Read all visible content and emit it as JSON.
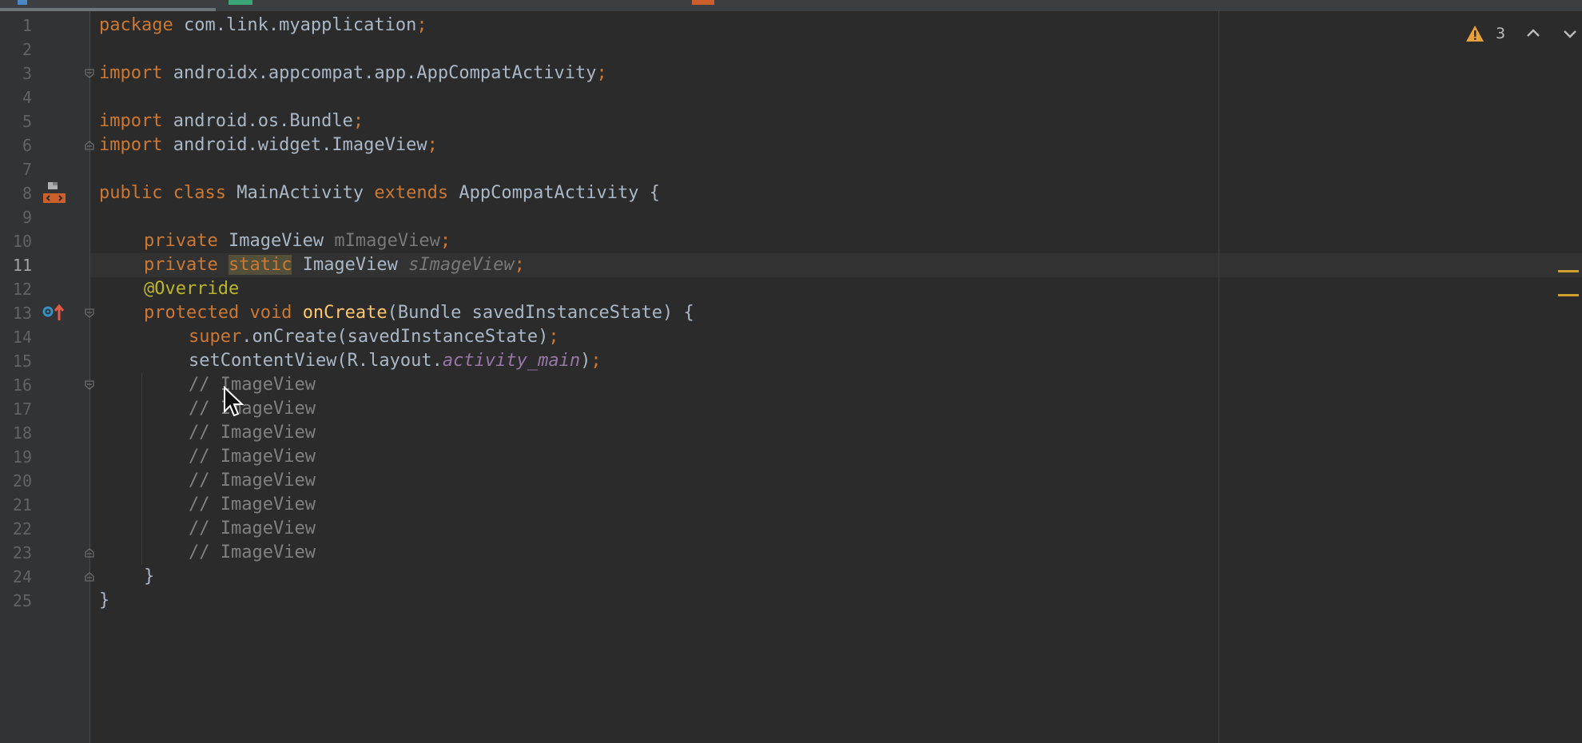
{
  "editor": {
    "current_line": 11,
    "lines": [
      {
        "n": "1",
        "t": ""
      },
      {
        "n": "2",
        "t": ""
      },
      {
        "n": "3",
        "t": ""
      },
      {
        "n": "4",
        "t": ""
      },
      {
        "n": "5",
        "t": ""
      },
      {
        "n": "6",
        "t": ""
      },
      {
        "n": "7",
        "t": ""
      },
      {
        "n": "8",
        "t": ""
      },
      {
        "n": "9",
        "t": ""
      },
      {
        "n": "10",
        "t": ""
      },
      {
        "n": "11",
        "t": ""
      },
      {
        "n": "12",
        "t": ""
      },
      {
        "n": "13",
        "t": ""
      },
      {
        "n": "14",
        "t": ""
      },
      {
        "n": "15",
        "t": ""
      },
      {
        "n": "16",
        "t": ""
      },
      {
        "n": "17",
        "t": ""
      },
      {
        "n": "18",
        "t": ""
      },
      {
        "n": "19",
        "t": ""
      },
      {
        "n": "20",
        "t": ""
      },
      {
        "n": "21",
        "t": ""
      },
      {
        "n": "22",
        "t": ""
      },
      {
        "n": "23",
        "t": ""
      },
      {
        "n": "24",
        "t": ""
      },
      {
        "n": "25",
        "t": ""
      }
    ],
    "tokens": {
      "l1_kw": "package",
      "l1_rest": " com.link.myapplication",
      "l1_semi": ";",
      "l3_kw": "import",
      "l3_rest": " androidx.appcompat.app.AppCompatActivity",
      "l3_semi": ";",
      "l5_kw": "import",
      "l5_rest": " android.os.Bundle",
      "l5_semi": ";",
      "l6_kw": "import",
      "l6_rest": " android.widget.ImageView",
      "l6_semi": ";",
      "l8_kw1": "public class",
      "l8_name": " MainActivity ",
      "l8_kw2": "extends",
      "l8_rest": " AppCompatActivity {",
      "l10_kw": "private",
      "l10_type": " ImageView ",
      "l10_field": "mImageView",
      "l10_semi": ";",
      "l11_kw": "private",
      "l11_static": "static",
      "l11_type": " ImageView ",
      "l11_field": "sImageView",
      "l11_semi": ";",
      "l12_ann": "@Override",
      "l13_kw": "protected void",
      "l13_fn": "onCreate",
      "l13_rest": "(Bundle savedInstanceState) {",
      "l14_kw": "super",
      "l14_rest": ".onCreate(savedInstanceState)",
      "l14_semi": ";",
      "l15_a": "setContentView(R.layout.",
      "l15_const": "activity_main",
      "l15_b": ")",
      "l15_semi": ";",
      "comment": "// ImageView",
      "l24": "}",
      "l25": "}"
    }
  },
  "inspection": {
    "warning_count": "3",
    "icons": [
      "warning-triangle-icon",
      "chevron-up-icon",
      "chevron-down-icon"
    ]
  },
  "colors": {
    "background": "#2b2b2b",
    "gutter": "#313335",
    "keyword": "#cc7832",
    "annotation": "#bbb529",
    "method": "#ffc66d",
    "constant": "#9876aa",
    "comment": "#808080",
    "warning_stripe": "#d0a12f"
  }
}
